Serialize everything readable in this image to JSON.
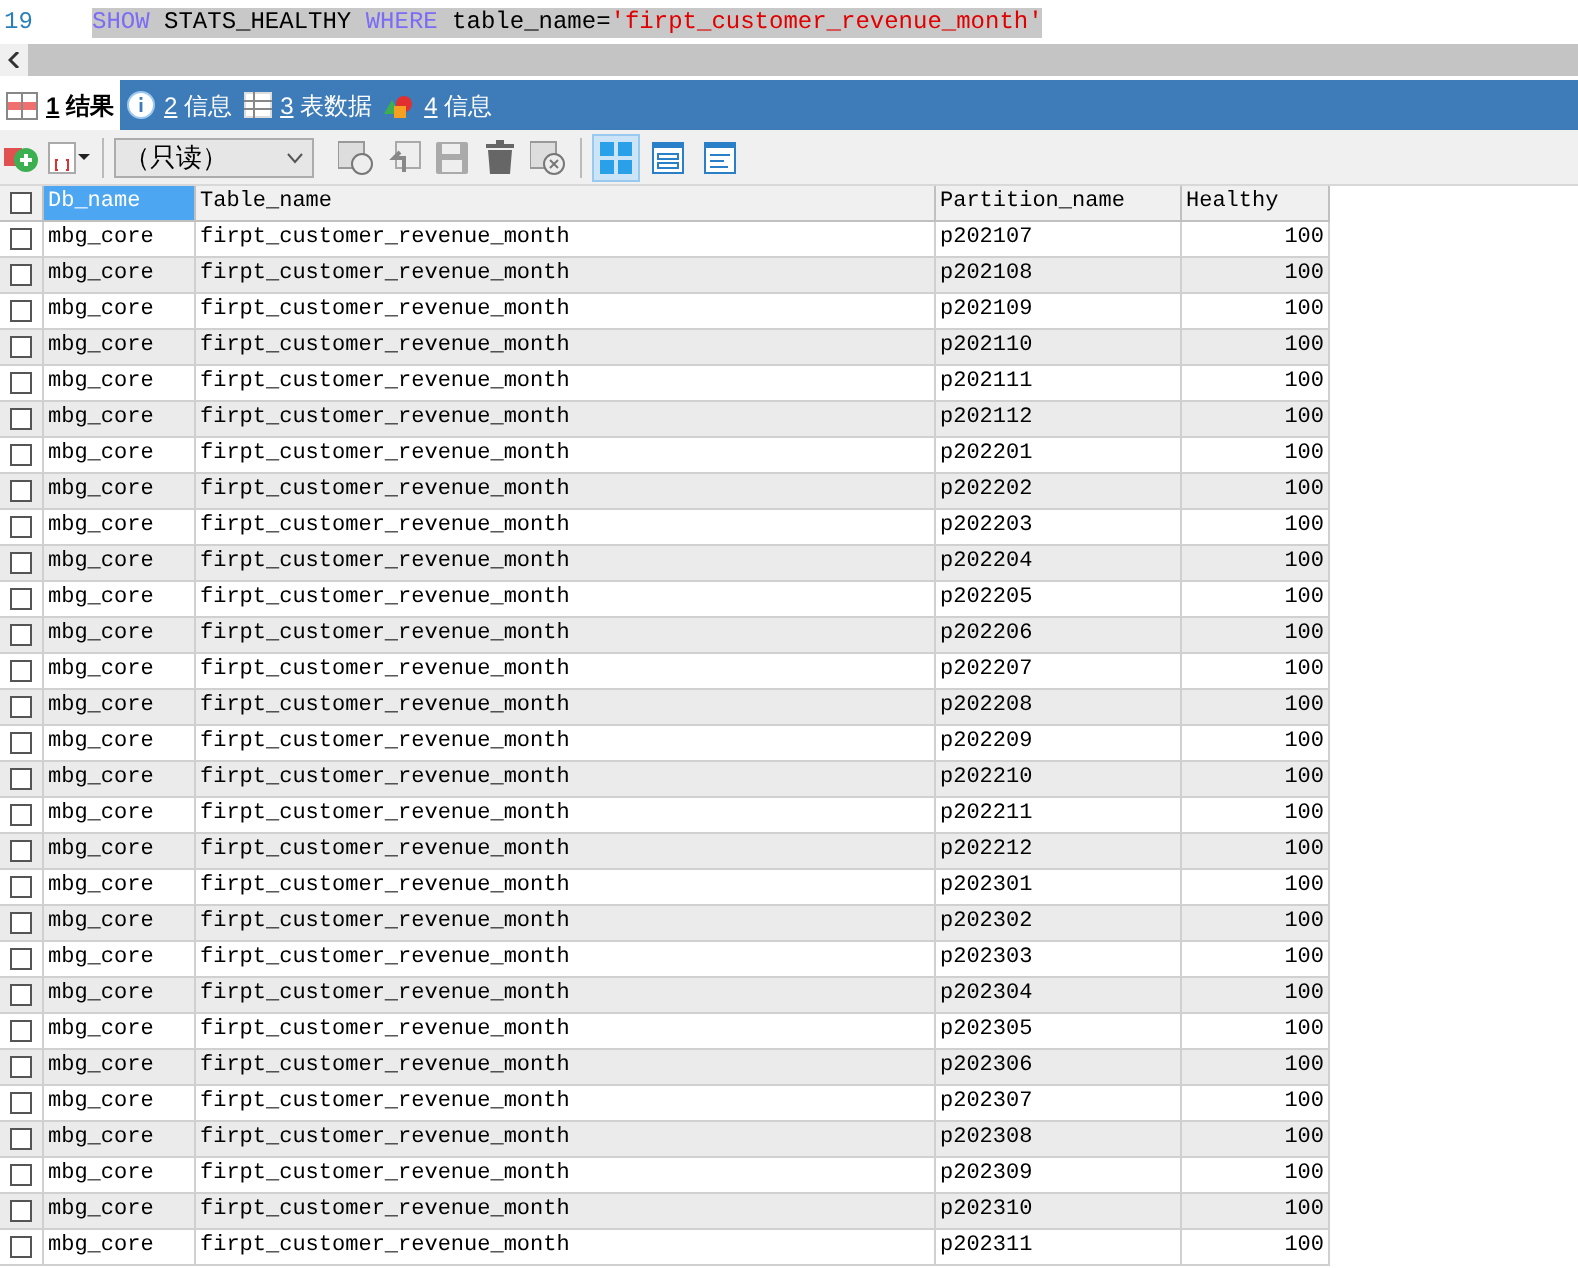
{
  "editor": {
    "line_number": "19",
    "tokens": [
      {
        "kind": "keyword",
        "text": "SHOW"
      },
      {
        "kind": "plain",
        "text": " STATS_HEALTHY "
      },
      {
        "kind": "keyword",
        "text": "WHERE"
      },
      {
        "kind": "plain",
        "text": " table_name="
      },
      {
        "kind": "string",
        "text": "'firpt_customer_revenue_month'"
      }
    ]
  },
  "tabs": [
    {
      "kind": "grid",
      "number": "1",
      "label": "结果",
      "selected": true
    },
    {
      "kind": "info",
      "number": "2",
      "label": "信息",
      "selected": false
    },
    {
      "kind": "table",
      "number": "3",
      "label": "表数据",
      "selected": false
    },
    {
      "kind": "shapes",
      "number": "4",
      "label": "信息",
      "selected": false
    }
  ],
  "toolbar": {
    "mode_select": {
      "value": "（只读）"
    },
    "views": [
      {
        "kind": "grid",
        "selected": true
      },
      {
        "kind": "form",
        "selected": false
      },
      {
        "kind": "text",
        "selected": false
      }
    ]
  },
  "table": {
    "select_all_checked": false,
    "columns": [
      {
        "label": "Db_name",
        "selected": true
      },
      {
        "label": "Table_name",
        "selected": false
      },
      {
        "label": "Partition_name",
        "selected": false
      },
      {
        "label": "Healthy",
        "selected": false
      }
    ],
    "rows": [
      {
        "checked": false,
        "cells": [
          "mbg_core",
          "firpt_customer_revenue_month",
          "p202107",
          "100"
        ]
      },
      {
        "checked": false,
        "cells": [
          "mbg_core",
          "firpt_customer_revenue_month",
          "p202108",
          "100"
        ]
      },
      {
        "checked": false,
        "cells": [
          "mbg_core",
          "firpt_customer_revenue_month",
          "p202109",
          "100"
        ]
      },
      {
        "checked": false,
        "cells": [
          "mbg_core",
          "firpt_customer_revenue_month",
          "p202110",
          "100"
        ]
      },
      {
        "checked": false,
        "cells": [
          "mbg_core",
          "firpt_customer_revenue_month",
          "p202111",
          "100"
        ]
      },
      {
        "checked": false,
        "cells": [
          "mbg_core",
          "firpt_customer_revenue_month",
          "p202112",
          "100"
        ]
      },
      {
        "checked": false,
        "cells": [
          "mbg_core",
          "firpt_customer_revenue_month",
          "p202201",
          "100"
        ]
      },
      {
        "checked": false,
        "cells": [
          "mbg_core",
          "firpt_customer_revenue_month",
          "p202202",
          "100"
        ]
      },
      {
        "checked": false,
        "cells": [
          "mbg_core",
          "firpt_customer_revenue_month",
          "p202203",
          "100"
        ]
      },
      {
        "checked": false,
        "cells": [
          "mbg_core",
          "firpt_customer_revenue_month",
          "p202204",
          "100"
        ]
      },
      {
        "checked": false,
        "cells": [
          "mbg_core",
          "firpt_customer_revenue_month",
          "p202205",
          "100"
        ]
      },
      {
        "checked": false,
        "cells": [
          "mbg_core",
          "firpt_customer_revenue_month",
          "p202206",
          "100"
        ]
      },
      {
        "checked": false,
        "cells": [
          "mbg_core",
          "firpt_customer_revenue_month",
          "p202207",
          "100"
        ]
      },
      {
        "checked": false,
        "cells": [
          "mbg_core",
          "firpt_customer_revenue_month",
          "p202208",
          "100"
        ]
      },
      {
        "checked": false,
        "cells": [
          "mbg_core",
          "firpt_customer_revenue_month",
          "p202209",
          "100"
        ]
      },
      {
        "checked": false,
        "cells": [
          "mbg_core",
          "firpt_customer_revenue_month",
          "p202210",
          "100"
        ]
      },
      {
        "checked": false,
        "cells": [
          "mbg_core",
          "firpt_customer_revenue_month",
          "p202211",
          "100"
        ]
      },
      {
        "checked": false,
        "cells": [
          "mbg_core",
          "firpt_customer_revenue_month",
          "p202212",
          "100"
        ]
      },
      {
        "checked": false,
        "cells": [
          "mbg_core",
          "firpt_customer_revenue_month",
          "p202301",
          "100"
        ]
      },
      {
        "checked": false,
        "cells": [
          "mbg_core",
          "firpt_customer_revenue_month",
          "p202302",
          "100"
        ]
      },
      {
        "checked": false,
        "cells": [
          "mbg_core",
          "firpt_customer_revenue_month",
          "p202303",
          "100"
        ]
      },
      {
        "checked": false,
        "cells": [
          "mbg_core",
          "firpt_customer_revenue_month",
          "p202304",
          "100"
        ]
      },
      {
        "checked": false,
        "cells": [
          "mbg_core",
          "firpt_customer_revenue_month",
          "p202305",
          "100"
        ]
      },
      {
        "checked": false,
        "cells": [
          "mbg_core",
          "firpt_customer_revenue_month",
          "p202306",
          "100"
        ]
      },
      {
        "checked": false,
        "cells": [
          "mbg_core",
          "firpt_customer_revenue_month",
          "p202307",
          "100"
        ]
      },
      {
        "checked": false,
        "cells": [
          "mbg_core",
          "firpt_customer_revenue_month",
          "p202308",
          "100"
        ]
      },
      {
        "checked": false,
        "cells": [
          "mbg_core",
          "firpt_customer_revenue_month",
          "p202309",
          "100"
        ]
      },
      {
        "checked": false,
        "cells": [
          "mbg_core",
          "firpt_customer_revenue_month",
          "p202310",
          "100"
        ]
      },
      {
        "checked": false,
        "cells": [
          "mbg_core",
          "firpt_customer_revenue_month",
          "p202311",
          "100"
        ]
      }
    ]
  }
}
